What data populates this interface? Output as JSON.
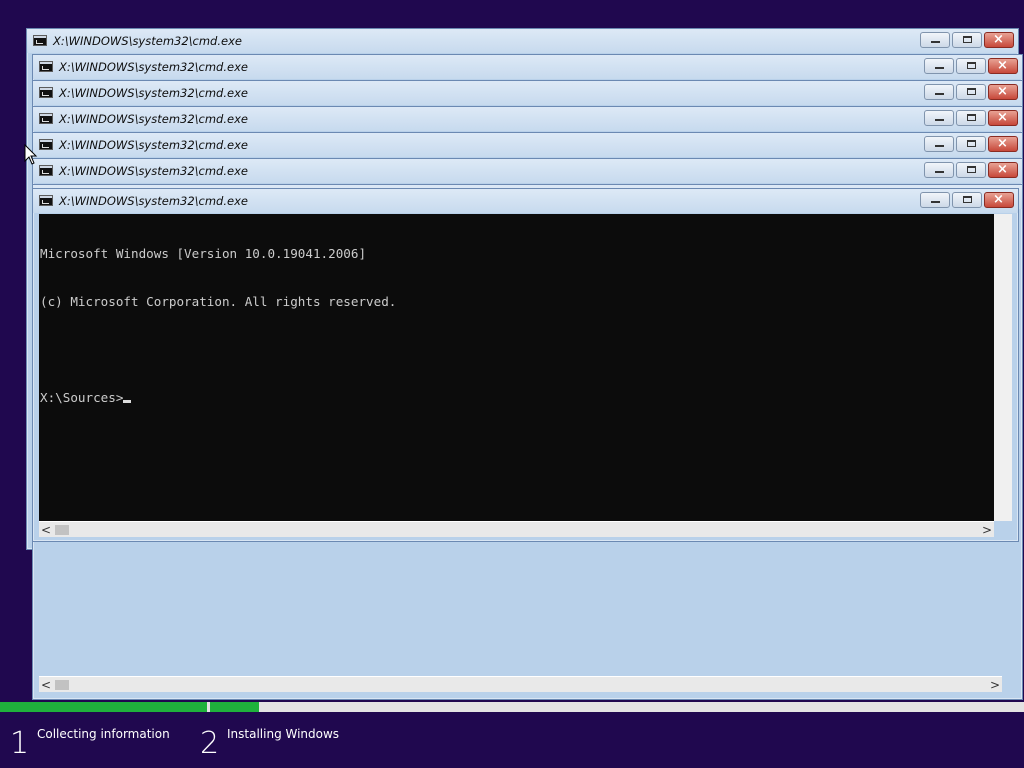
{
  "window_title": "X:\\WINDOWS\\system32\\cmd.exe",
  "console": {
    "lines": [
      "Microsoft Windows [Version 10.0.19041.2006]",
      "(c) Microsoft Corporation. All rights reserved.",
      "",
      "X:\\Sources>"
    ]
  },
  "scroll_arrows": {
    "left": "<",
    "right": ">"
  },
  "window_buttons": {
    "close_glyph": "×"
  },
  "setup_progress": {
    "steps": [
      {
        "number": "1",
        "label": "Collecting information"
      },
      {
        "number": "2",
        "label": "Installing Windows"
      }
    ],
    "step1_progress": 1.0,
    "step2_progress": 0.06,
    "color": "#1fb13c"
  },
  "colors": {
    "background": "#20084f",
    "console_bg": "#0c0c0c",
    "console_text": "#cccccc",
    "close_button": "#c7483a"
  }
}
